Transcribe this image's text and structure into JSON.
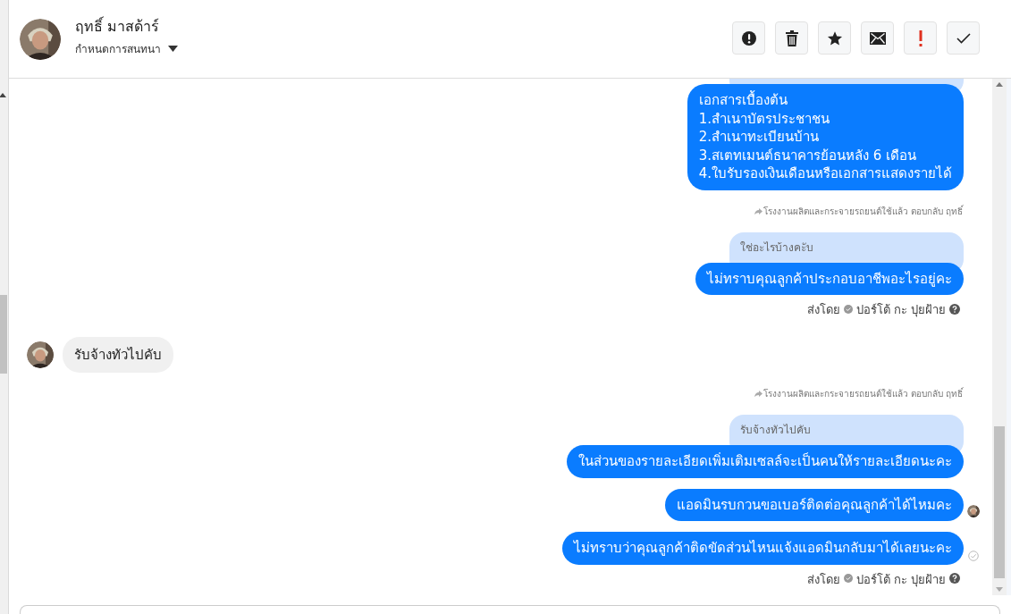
{
  "header": {
    "name": "ฤทธิ์ มาสด้าร์",
    "subtitle": "กำหนดการสนทนา"
  },
  "actions": [
    {
      "kind": "alert"
    },
    {
      "kind": "trash"
    },
    {
      "kind": "star"
    },
    {
      "kind": "mail"
    },
    {
      "kind": "exclaim"
    },
    {
      "kind": "check"
    }
  ],
  "messages": [
    {
      "kind": "quote"
    },
    {
      "kind": "outgoing",
      "lines": [
        "เอกสารเบื้องต้น",
        "1.สำเนาบัตรประชาชน",
        "2.สำเนาทะเบียนบ้าน",
        "3.สเตทเมนต์ธนาคารย้อนหลัง 6 เดือน",
        "4.ใบรับรองเงินเดือนหรือเอกสารแสดงรายได้"
      ]
    },
    {
      "kind": "reply_note",
      "text": "โรงงานผลิตและกระจายรถยนต์ใช้แล้ว ตอบกลับ ฤทธิ์"
    },
    {
      "kind": "quote",
      "text": "ใช่อะไรบ้างคะับ"
    },
    {
      "kind": "outgoing",
      "lines": [
        "ไม่ทราบคุณลูกค้าประกอบอาชีพอะไรอยู่คะ"
      ]
    },
    {
      "kind": "sender",
      "label": "ส่งโดย",
      "name": "ปอร์โต้ กะ ปุยฝ้าย"
    },
    {
      "kind": "incoming",
      "text": "รับจ้างทัวไปคับ"
    },
    {
      "kind": "reply_note",
      "text": "โรงงานผลิตและกระจายรถยนต์ใช้แล้ว ตอบกลับ ฤทธิ์"
    },
    {
      "kind": "quote",
      "text": "รับจ้างทัวไปคับ"
    },
    {
      "kind": "outgoing",
      "lines": [
        "ในส่วนของรายละเอียดเพิ่มเติมเซลล์จะเป็นคนให้รายละเอียดนะคะ"
      ]
    },
    {
      "kind": "outgoing",
      "lines": [
        "แอดมินรบกวนขอเบอร์ติดต่อคุณลูกค้าได้ไหมคะ"
      ],
      "seen": true
    },
    {
      "kind": "outgoing",
      "lines": [
        "ไม่ทราบว่าคุณลูกค้าติดขัดส่วนไหนแจ้งแอดมินกลับมาได้เลยนะคะ"
      ],
      "seen": false
    },
    {
      "kind": "sender",
      "label": "ส่งโดย",
      "name": "ปอร์โต้ กะ ปุยฝ้าย"
    }
  ]
}
